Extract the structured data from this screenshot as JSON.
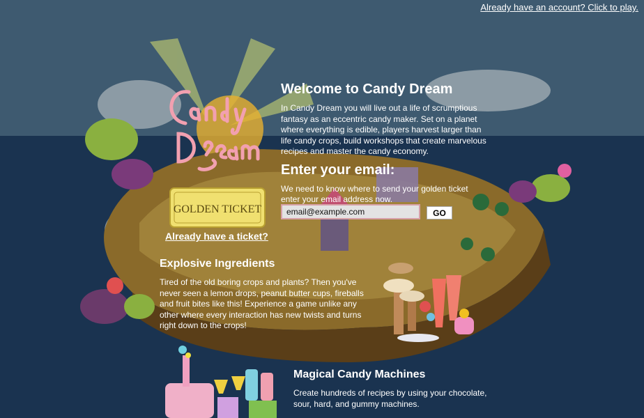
{
  "header": {
    "account_link": "Already have an account? Click to play."
  },
  "logo": {
    "name": "candy-dream-logo"
  },
  "ticket": {
    "image_text": "GOLDEN TICKET",
    "link": "Already have a ticket?"
  },
  "welcome": {
    "title": "Welcome to Candy Dream",
    "text": "In Candy Dream you will live out a life of scrumptious fantasy as an eccentric candy maker. Set on a planet where everything is edible, players harvest larger than life candy crops, build workshops that create marvelous recipes and master the candy economy."
  },
  "email": {
    "title": "Enter your email:",
    "text": "We need to know where to send your golden ticket enter your email address now.",
    "input_value": "email@example.com",
    "go_label": "GO"
  },
  "features": {
    "ingredients": {
      "title": "Explosive Ingredients",
      "text": "Tired of the old boring crops and plants? Then you've never seen a lemon drops, peanut butter cups, fireballs and fruit bites like this! Experience a game unlike any other where every interaction has new twists and turns right down to the crops!"
    },
    "machines": {
      "title": "Magical Candy Machines",
      "text": "Create hundreds of recipes by using your chocolate, sour, hard, and gummy machines."
    }
  },
  "colors": {
    "sky": "#3e5a70",
    "sea": "#1a3350",
    "island": "#8a6a2a",
    "logo_pink": "#f2a0b0",
    "ticket_gold": "#f0e070"
  }
}
